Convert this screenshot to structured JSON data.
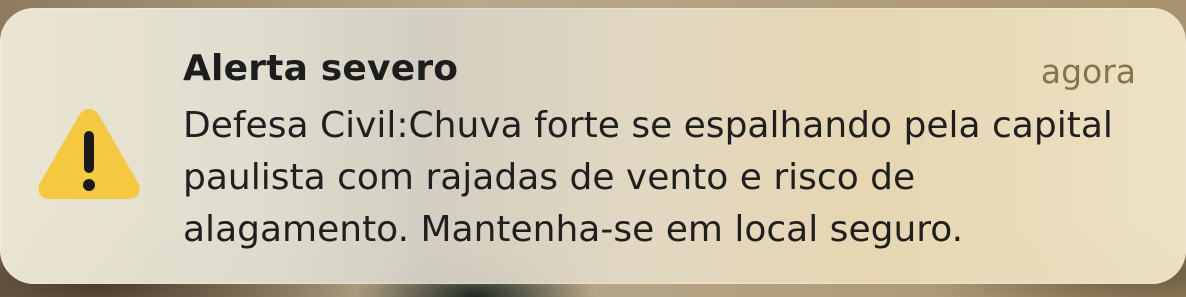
{
  "notification": {
    "title": "Alerta severo",
    "timestamp": "agora",
    "message": "Defesa Civil:Chuva forte se espalhando pela capital paulista com rajadas de vento e risco de alagamento. Mantenha-se em local seguro.",
    "icon": "warning-triangle-icon",
    "colors": {
      "icon_fill": "#F5C842",
      "icon_mark": "#1a1a1a",
      "title": "#1d1d1d",
      "timestamp": "#86744a",
      "message": "#1f1f1f"
    }
  }
}
